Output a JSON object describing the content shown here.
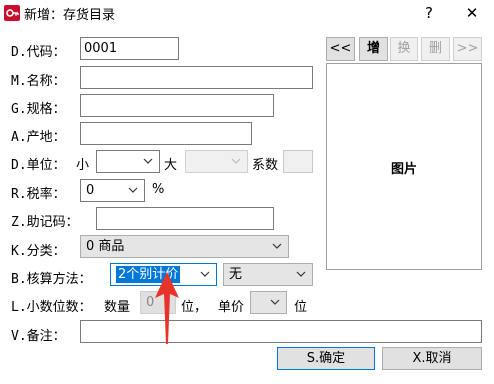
{
  "window": {
    "title": "新增：存货目录",
    "help": "?",
    "close": "✕"
  },
  "fields": {
    "code": {
      "label": "D.代码：",
      "value": "0001"
    },
    "name": {
      "label": "M.名称：",
      "value": ""
    },
    "spec": {
      "label": "G.规格：",
      "value": ""
    },
    "origin": {
      "label": "A.产地：",
      "value": ""
    },
    "unit": {
      "label": "D.单位：",
      "small_label": "小",
      "small_value": "",
      "large_label": "大",
      "large_value": "",
      "factor_label": "系数",
      "factor_value": ""
    },
    "tax": {
      "label": "R.税率：",
      "value": "0",
      "suffix": "%"
    },
    "mnemonic": {
      "label": "Z.助记码：",
      "value": ""
    },
    "category": {
      "label": "K.分类：",
      "value": "0 商品"
    },
    "costing": {
      "label": "B.核算方法：",
      "method": "2个别计价",
      "option": "无"
    },
    "decimals": {
      "label": "L.小数位数：",
      "qty_label": "数量",
      "qty_value": "0",
      "unit1": "位，",
      "price_label": "单价",
      "price_value": "",
      "unit2": "位"
    },
    "note": {
      "label": "V.备注：",
      "value": ""
    }
  },
  "nav_buttons": {
    "prev": "<<",
    "add": "增",
    "replace": "换",
    "delete": "删",
    "next": ">>"
  },
  "picture": {
    "label": "图片"
  },
  "actions": {
    "ok": "S.确定",
    "cancel": "X.取消"
  },
  "colors": {
    "accent": "#0078d7",
    "annotation_arrow": "#e8332a",
    "app_icon": "#c8102e"
  },
  "icons": [
    "app-key-icon",
    "chevron-down-icon",
    "help-icon",
    "close-icon",
    "red-arrow-annotation"
  ]
}
